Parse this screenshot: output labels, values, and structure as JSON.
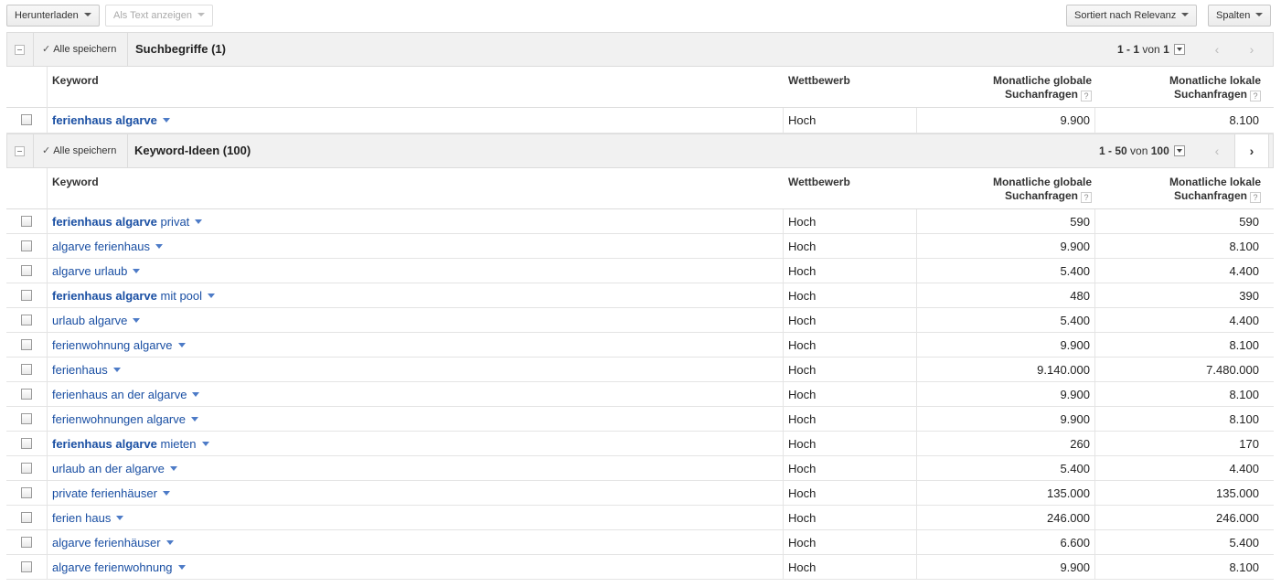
{
  "toolbar": {
    "download_label": "Herunterladen",
    "show_as_text_label": "Als Text anzeigen",
    "sort_label": "Sortiert nach Relevanz",
    "columns_label": "Spalten"
  },
  "search_terms": {
    "save_all": "Alle speichern",
    "title": "Suchbegriffe (1)",
    "pager_range": "1 - 1",
    "pager_of": "von",
    "pager_total": "1",
    "prev_icon": "chevron-left-icon",
    "next_icon": "chevron-right-icon"
  },
  "keyword_ideas": {
    "save_all": "Alle speichern",
    "title": "Keyword-Ideen (100)",
    "pager_range": "1 - 50",
    "pager_of": "von",
    "pager_total": "100",
    "prev_icon": "chevron-left-icon",
    "next_icon": "chevron-right-icon"
  },
  "columns": {
    "keyword": "Keyword",
    "competition": "Wettbewerb",
    "global_line1": "Monatliche globale",
    "global_line2": "Suchanfragen",
    "local_line1": "Monatliche lokale",
    "local_line2": "Suchanfragen",
    "help": "?"
  },
  "search_rows": [
    {
      "kw_bold": "ferienhaus algarve",
      "kw_rest": "",
      "competition": "Hoch",
      "global": "9.900",
      "local": "8.100"
    }
  ],
  "idea_rows": [
    {
      "kw_bold": "ferienhaus algarve",
      "kw_rest": " privat",
      "competition": "Hoch",
      "global": "590",
      "local": "590"
    },
    {
      "kw_bold": "",
      "kw_rest": "algarve ferienhaus",
      "competition": "Hoch",
      "global": "9.900",
      "local": "8.100"
    },
    {
      "kw_bold": "",
      "kw_rest": "algarve urlaub",
      "competition": "Hoch",
      "global": "5.400",
      "local": "4.400"
    },
    {
      "kw_bold": "ferienhaus algarve",
      "kw_rest": " mit pool",
      "competition": "Hoch",
      "global": "480",
      "local": "390"
    },
    {
      "kw_bold": "",
      "kw_rest": "urlaub algarve",
      "competition": "Hoch",
      "global": "5.400",
      "local": "4.400"
    },
    {
      "kw_bold": "",
      "kw_rest": "ferienwohnung algarve",
      "competition": "Hoch",
      "global": "9.900",
      "local": "8.100"
    },
    {
      "kw_bold": "",
      "kw_rest": "ferienhaus",
      "competition": "Hoch",
      "global": "9.140.000",
      "local": "7.480.000"
    },
    {
      "kw_bold": "",
      "kw_rest": "ferienhaus an der algarve",
      "competition": "Hoch",
      "global": "9.900",
      "local": "8.100"
    },
    {
      "kw_bold": "",
      "kw_rest": "ferienwohnungen algarve",
      "competition": "Hoch",
      "global": "9.900",
      "local": "8.100"
    },
    {
      "kw_bold": "ferienhaus algarve",
      "kw_rest": " mieten",
      "competition": "Hoch",
      "global": "260",
      "local": "170"
    },
    {
      "kw_bold": "",
      "kw_rest": "urlaub an der algarve",
      "competition": "Hoch",
      "global": "5.400",
      "local": "4.400"
    },
    {
      "kw_bold": "",
      "kw_rest": "private ferienhäuser",
      "competition": "Hoch",
      "global": "135.000",
      "local": "135.000"
    },
    {
      "kw_bold": "",
      "kw_rest": "ferien haus",
      "competition": "Hoch",
      "global": "246.000",
      "local": "246.000"
    },
    {
      "kw_bold": "",
      "kw_rest": "algarve ferienhäuser",
      "competition": "Hoch",
      "global": "6.600",
      "local": "5.400"
    },
    {
      "kw_bold": "",
      "kw_rest": "algarve ferienwohnung",
      "competition": "Hoch",
      "global": "9.900",
      "local": "8.100"
    }
  ],
  "colors": {
    "link": "#1a4fa3",
    "header_bg": "#f1f1f1",
    "border": "#dcdcdc"
  }
}
